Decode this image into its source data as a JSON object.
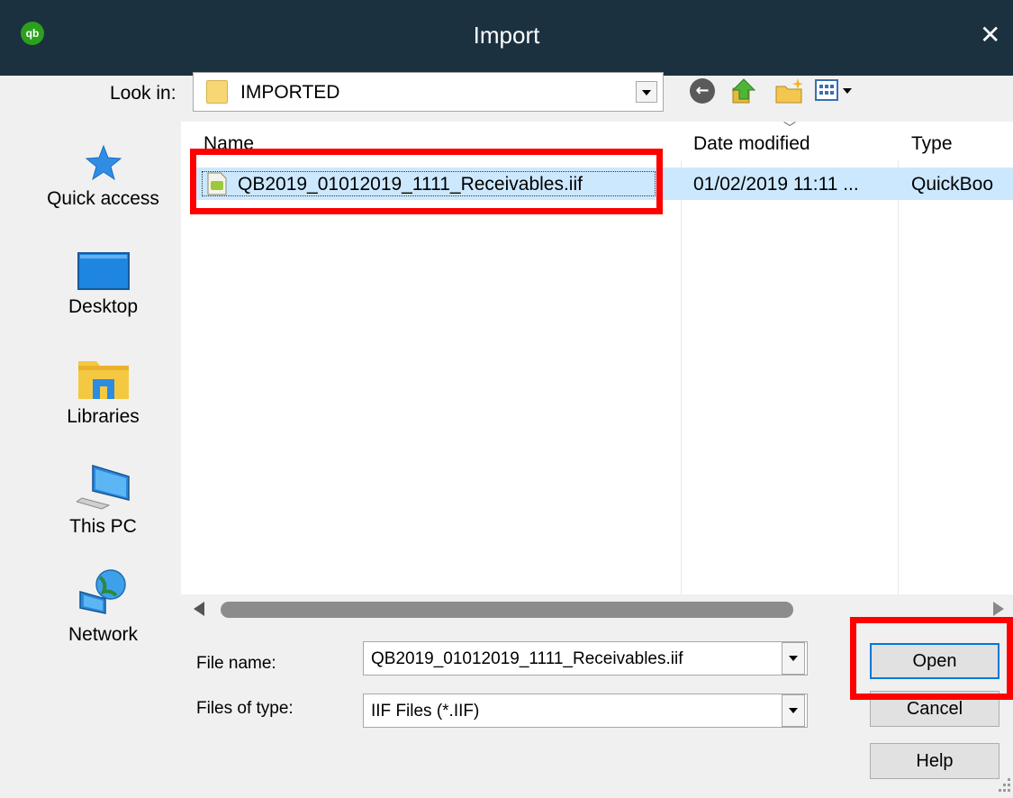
{
  "window": {
    "title": "Import",
    "logo_text": "qb",
    "close_glyph": "✕"
  },
  "toolbar": {
    "look_in_label": "Look in:",
    "look_in_value": "IMPORTED",
    "icons": [
      "back-icon",
      "up-folder-icon",
      "new-folder-icon",
      "view-menu-icon"
    ]
  },
  "places": [
    {
      "label": "Quick access",
      "icon": "star-icon"
    },
    {
      "label": "Desktop",
      "icon": "desktop-icon"
    },
    {
      "label": "Libraries",
      "icon": "libraries-icon"
    },
    {
      "label": "This PC",
      "icon": "computer-icon"
    },
    {
      "label": "Network",
      "icon": "network-icon"
    }
  ],
  "file_list": {
    "columns": [
      "Name",
      "Date modified",
      "Type"
    ],
    "rows": [
      {
        "name": "QB2019_01012019_1111_Receivables.iif",
        "date": "01/02/2019 11:11 ...",
        "type": "QuickBoo",
        "selected": true
      }
    ]
  },
  "form": {
    "file_name_label": "File name:",
    "file_name_value": "QB2019_01012019_1111_Receivables.iif",
    "file_type_label": "Files of type:",
    "file_type_value": "IIF Files (*.IIF)"
  },
  "buttons": {
    "open": "Open",
    "cancel": "Cancel",
    "help": "Help"
  },
  "colors": {
    "titlebar": "#1b3140",
    "selection": "#cce8ff",
    "highlight_box": "#ff0000",
    "qb_green": "#2ca01c"
  }
}
